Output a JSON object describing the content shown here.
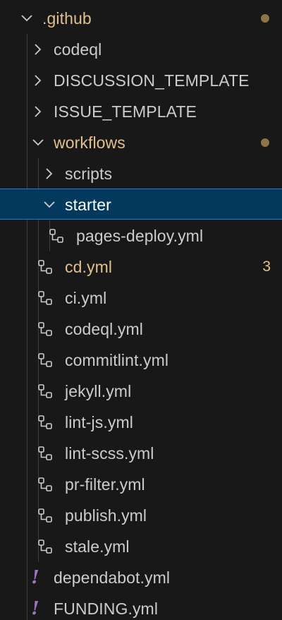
{
  "tree": {
    "github_folder": {
      "label": ".github",
      "state": "expanded",
      "modified": true
    },
    "codeql_folder": {
      "label": "codeql",
      "state": "collapsed"
    },
    "discussion_folder": {
      "label": "DISCUSSION_TEMPLATE",
      "state": "collapsed"
    },
    "issue_folder": {
      "label": "ISSUE_TEMPLATE",
      "state": "collapsed"
    },
    "workflows_folder": {
      "label": "workflows",
      "state": "expanded",
      "modified": true
    },
    "scripts_folder": {
      "label": "scripts",
      "state": "collapsed"
    },
    "starter_folder": {
      "label": "starter",
      "state": "expanded",
      "selected": true
    },
    "files": {
      "pages_deploy": "pages-deploy.yml",
      "cd": "cd.yml",
      "cd_problems": "3",
      "ci": "ci.yml",
      "codeql": "codeql.yml",
      "commitlint": "commitlint.yml",
      "jekyll": "jekyll.yml",
      "lint_js": "lint-js.yml",
      "lint_scss": "lint-scss.yml",
      "pr_filter": "pr-filter.yml",
      "publish": "publish.yml",
      "stale": "stale.yml",
      "dependabot": "dependabot.yml",
      "funding": "FUNDING.yml"
    }
  },
  "colors": {
    "background": "#181818",
    "text": "#cccccc",
    "modified": "#e2c08d",
    "selection_bg": "#04395e",
    "selection_border": "#2b79d6",
    "yaml_icon": "#a074c4"
  },
  "icons": {
    "chevron_right": "chevron-right-icon",
    "chevron_down": "chevron-down-icon",
    "workflow_file": "workflow-icon",
    "yaml_file": "yaml-exclamation-icon"
  }
}
